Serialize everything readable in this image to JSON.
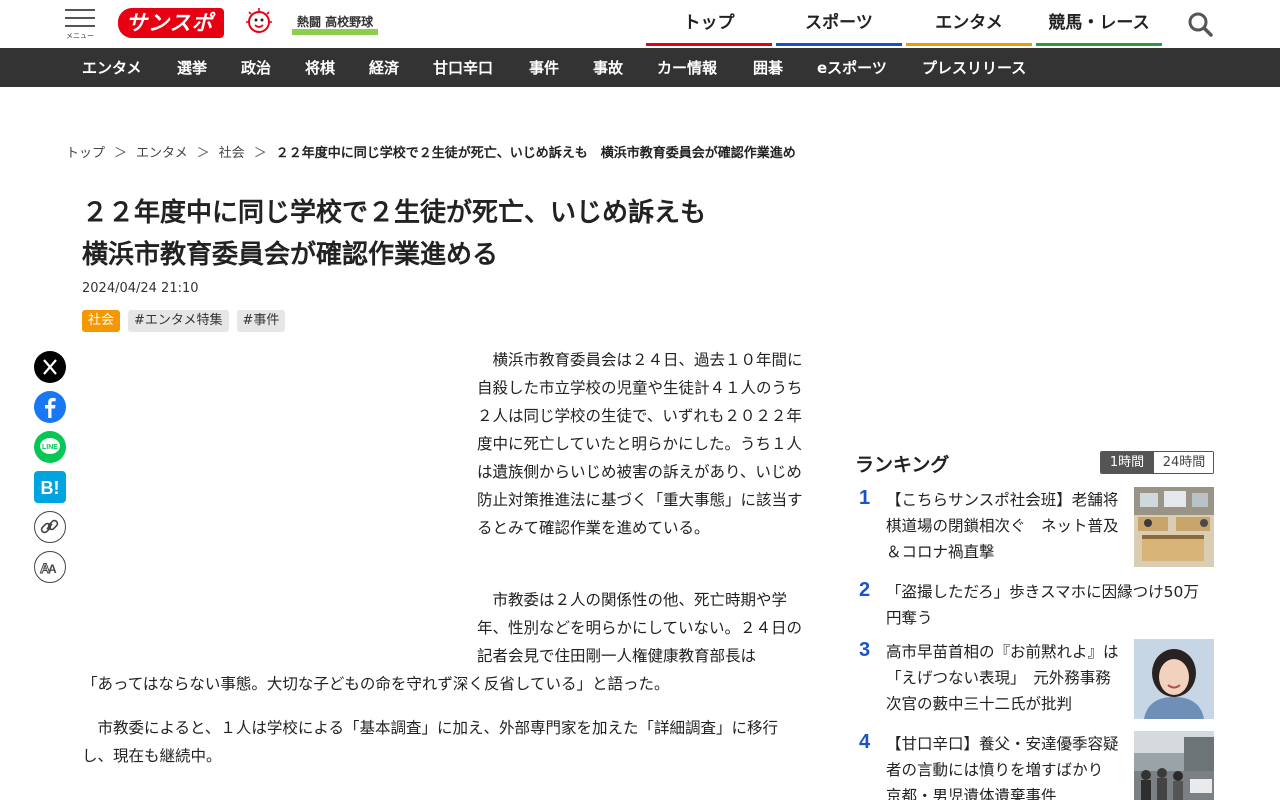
{
  "header": {
    "menu_label": "メニュー",
    "logo_text": "サンスポ",
    "koshien_label": "熱闘 高校野球",
    "nav": [
      {
        "label": "トップ",
        "color": "#e60012"
      },
      {
        "label": "スポーツ",
        "color": "#1a4fc8"
      },
      {
        "label": "エンタメ",
        "color": "#f39800"
      },
      {
        "label": "競馬・レース",
        "color": "#2a9a3a"
      }
    ],
    "search_icon": "search-icon"
  },
  "subnav": [
    "エンタメ",
    "選挙",
    "政治",
    "将棋",
    "経済",
    "甘口辛口",
    "事件",
    "事故",
    "カー情報",
    "囲碁",
    "eスポーツ",
    "プレスリリース"
  ],
  "breadcrumb": {
    "items": [
      "トップ",
      "エンタメ",
      "社会"
    ],
    "separator": "＞",
    "current": "２２年度中に同じ学校で２生徒が死亡、いじめ訴えも　横浜市教育委員会が確認作業進め"
  },
  "article": {
    "title_line1": "２２年度中に同じ学校で２生徒が死亡、いじめ訴えも",
    "title_line2": "横浜市教育委員会が確認作業進める",
    "date": "2024/04/24 21:10",
    "tags": [
      {
        "label": "社会",
        "style": "primary"
      },
      {
        "label": "#エンタメ特集",
        "style": "secondary"
      },
      {
        "label": "#事件",
        "style": "secondary"
      }
    ],
    "paragraph1": "横浜市教育委員会は２４日、過去１０年間に自殺した市立学校の児童や生徒計４１人のうち２人は同じ学校の生徒で、いずれも２０２２年度中に死亡していたと明らかにした。うち１人は遺族側からいじめ被害の訴えがあり、いじめ防止対策推進法に基づく「重大事態」に該当するとみて確認作業を進めている。",
    "paragraph2_part1": "市教委は２人の関係性の他、死亡時期や学年、性別などを明らかにしていない。２４日の記者会見で住田剛一人権健康教育部長は",
    "paragraph2_part2": "「あってはならない事態。大切な子どもの命を守れず深く反省している」と語った。",
    "paragraph3": "市教委によると、１人は学校による「基本調査」に加え、外部専門家を加えた「詳細調査」に移行し、現在も継続中。"
  },
  "share": [
    "x-icon",
    "facebook-icon",
    "line-icon",
    "hatena-bookmark-icon",
    "copy-link-icon",
    "font-size-icon"
  ],
  "ranking": {
    "title": "ランキング",
    "tabs": [
      "1時間",
      "24時間"
    ],
    "items": [
      {
        "rank": "1",
        "text": "【こちらサンスポ社会班】老舗将棋道場の閉鎖相次ぐ　ネット普及＆コロナ禍直撃",
        "has_thumb": true
      },
      {
        "rank": "2",
        "text": "「盗撮しただろ」歩きスマホに因縁つけ50万円奪う",
        "has_thumb": false
      },
      {
        "rank": "3",
        "text": "高市早苗首相の『お前黙れよ』は「えげつない表現」　元外務事務次官の藪中三十二氏が批判",
        "has_thumb": true
      },
      {
        "rank": "4",
        "text": "【甘口辛口】養父・安達優季容疑者の言動には憤りを増すばかり　京都・男児遺体遺棄事件",
        "has_thumb": true
      }
    ]
  },
  "colors": {
    "brand_red": "#e60012",
    "subnav_bg": "#333333",
    "rank_blue": "#1a53c9",
    "tag_orange": "#f39800"
  }
}
